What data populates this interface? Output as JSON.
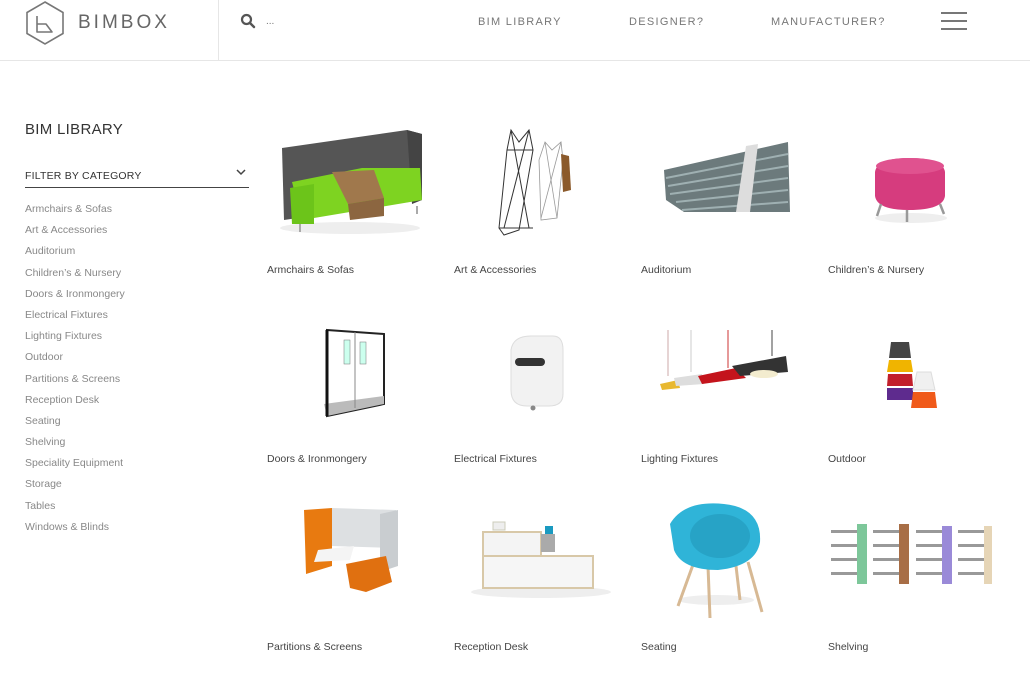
{
  "header": {
    "logo_text": "BIMBOX",
    "search_placeholder": "...",
    "nav": [
      {
        "label": "BIM LIBRARY"
      },
      {
        "label": "DESIGNER?"
      },
      {
        "label": "MANUFACTURER?"
      }
    ],
    "icons": {
      "logo": "hexagon-b-logo",
      "search": "search-icon",
      "menu": "hamburger-menu-icon"
    }
  },
  "sidebar": {
    "title": "BIM LIBRARY",
    "filter_label": "FILTER BY CATEGORY",
    "filter_icon": "chevron-down-icon",
    "categories": [
      "Armchairs & Sofas",
      "Art & Accessories",
      "Auditorium",
      "Children’s & Nursery",
      "Doors & Ironmongery",
      "Electrical Fixtures",
      "Lighting Fixtures",
      "Outdoor",
      "Partitions & Screens",
      "Reception Desk",
      "Seating",
      "Shelving",
      "Speciality Equipment",
      "Storage",
      "Tables",
      "Windows & Blinds"
    ]
  },
  "grid": {
    "cards": [
      {
        "label": "Armchairs & Sofas",
        "image": "green-booth-sofa"
      },
      {
        "label": "Art & Accessories",
        "image": "wire-coat-stands"
      },
      {
        "label": "Auditorium",
        "image": "tiered-auditorium-seats"
      },
      {
        "label": "Children’s & Nursery",
        "image": "pink-pouf-stool"
      },
      {
        "label": "Doors & Ironmongery",
        "image": "double-swing-doors"
      },
      {
        "label": "Electrical Fixtures",
        "image": "white-hand-dryer"
      },
      {
        "label": "Lighting Fixtures",
        "image": "pendant-lamps"
      },
      {
        "label": "Outdoor",
        "image": "stacked-colored-lamps"
      },
      {
        "label": "Partitions & Screens",
        "image": "orange-work-pod"
      },
      {
        "label": "Reception Desk",
        "image": "white-reception-desk"
      },
      {
        "label": "Seating",
        "image": "blue-bucket-chair"
      },
      {
        "label": "Shelving",
        "image": "library-shelving-units"
      }
    ]
  }
}
